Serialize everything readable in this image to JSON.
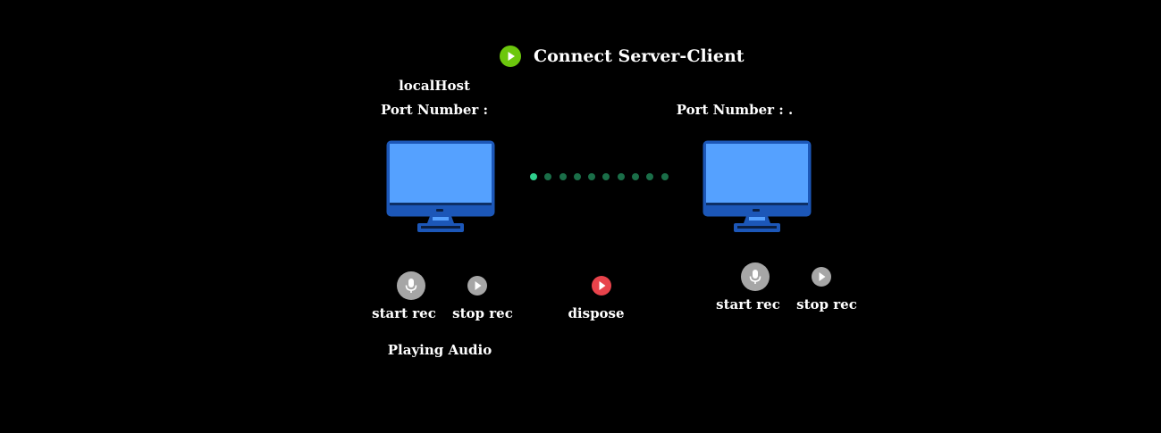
{
  "header": {
    "connect_label": "Connect Server-Client",
    "connect_icon": "play-icon",
    "connect_color": "#6cc70d"
  },
  "server": {
    "host_label": "localHost",
    "port_label": "Port Number :",
    "start_rec_label": "start rec",
    "stop_rec_label": "stop rec",
    "status_text": "Playing Audio"
  },
  "client": {
    "port_label": "Port Number : .",
    "start_rec_label": "start rec",
    "stop_rec_label": "stop rec"
  },
  "center": {
    "dispose_label": "dispose",
    "dispose_color": "#e8434b"
  },
  "colors": {
    "background": "#000000",
    "monitor_frame": "#1c57b8",
    "monitor_screen": "#55a1ff",
    "button_gray": "#a6a6a6",
    "dot_active": "#2fcf8d",
    "dot_idle": "#1a6e48"
  },
  "icons": [
    "play-icon",
    "monitor-icon",
    "microphone-icon"
  ]
}
